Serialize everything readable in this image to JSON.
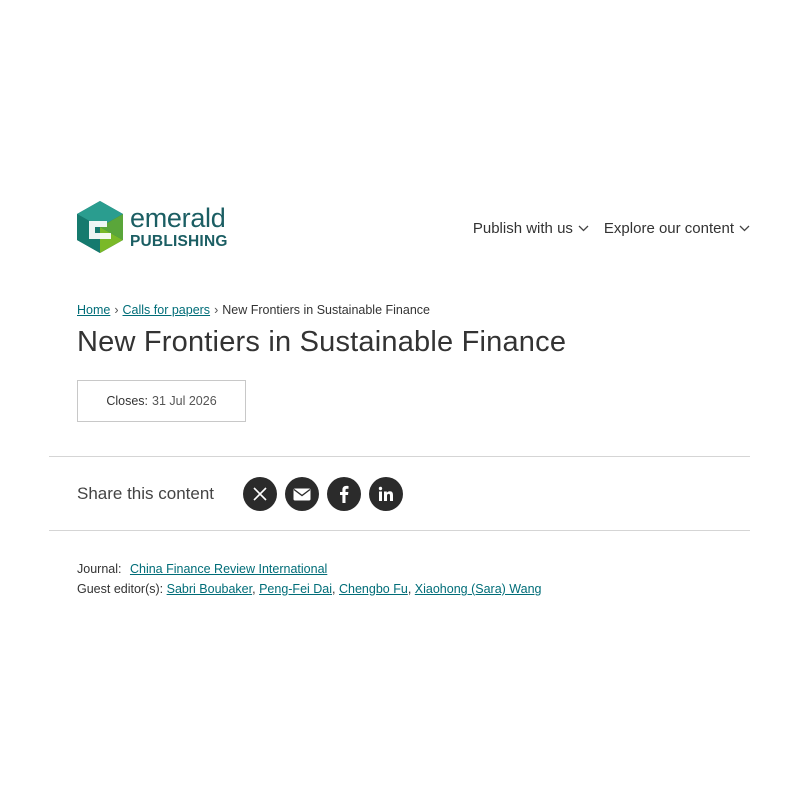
{
  "brand": {
    "line1": "emerald",
    "line2": "PUBLISHING",
    "colors": {
      "teal": "#1b5e63",
      "green": "#7ab928",
      "link": "#006d78"
    }
  },
  "nav": {
    "items": [
      {
        "label": "Publish with us",
        "icon": "chevron-down-icon"
      },
      {
        "label": "Explore our content",
        "icon": "chevron-down-icon"
      }
    ]
  },
  "breadcrumb": {
    "home": "Home",
    "sep1": "›",
    "calls": "Calls for papers",
    "sep2": "›",
    "current": "New Frontiers in Sustainable Finance"
  },
  "page": {
    "title": "New Frontiers in Sustainable Finance",
    "closes_label": "Closes:",
    "closes_value": "31 Jul 2026"
  },
  "share": {
    "label": "Share this content",
    "icons": [
      "x-icon",
      "email-icon",
      "facebook-icon",
      "linkedin-icon"
    ]
  },
  "meta": {
    "journal_label": "Journal:",
    "journal_name": "China Finance Review International",
    "editors_label": "Guest editor(s):",
    "editors": [
      "Sabri Boubaker",
      "Peng-Fei Dai",
      "Chengbo Fu",
      "Xiaohong (Sara) Wang"
    ],
    "editor_sep": ","
  }
}
